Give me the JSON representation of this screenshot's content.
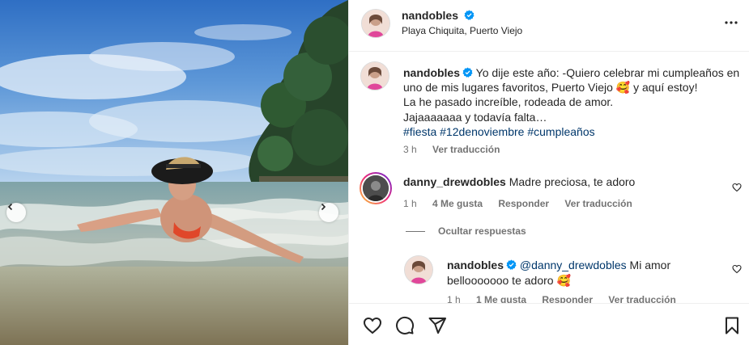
{
  "post": {
    "username": "nandobles",
    "location": "Playa Chiquita, Puerto Viejo"
  },
  "caption": {
    "username": "nandobles",
    "lines": [
      "Yo dije este año: -Quiero celebrar mi cumpleaños en",
      "uno de mis lugares favoritos, Puerto Viejo 🥰 y aquí estoy!",
      "La he pasado increíble, rodeada de amor.",
      "Jajaaaaaaa y todavía falta…"
    ],
    "hashtags": [
      "#fiesta",
      "#12denoviembre",
      "#cumpleaños"
    ],
    "time": "3 h",
    "translate": "Ver traducción"
  },
  "comment1": {
    "username": "danny_drewdobles",
    "text": "Madre preciosa, te adoro",
    "time": "1 h",
    "likes": "4 Me gusta",
    "reply": "Responder",
    "translate": "Ver traducción"
  },
  "hide_replies": "Ocultar respuestas",
  "reply1": {
    "username": "nandobles",
    "mention": "@danny_drewdobles",
    "text_line1": " Mi amor",
    "text_line2": "bellooooooo te adoro 🥰",
    "time": "1 h",
    "likes": "1 Me gusta",
    "reply": "Responder",
    "translate": "Ver traducción"
  },
  "icons": {
    "more": "more-horizontal-icon",
    "like": "heart-icon",
    "comment": "comment-icon",
    "share": "share-icon",
    "save": "bookmark-icon",
    "verified": "verified-badge-icon",
    "prev": "chevron-left-icon",
    "next": "chevron-right-icon"
  },
  "colors": {
    "link": "#00376b",
    "verified": "#0095f6",
    "muted": "#737373"
  }
}
